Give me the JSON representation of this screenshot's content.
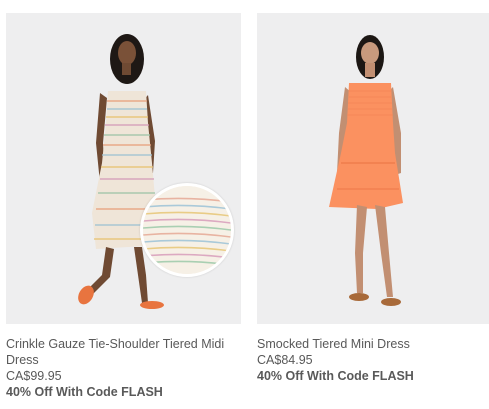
{
  "products": [
    {
      "name": "Crinkle Gauze Tie-Shoulder Tiered Midi Dress",
      "price": "CA$99.95",
      "promo": "40% Off With Code FLASH",
      "color": "#ece3d6",
      "swatch_icon": "stripe-swatch"
    },
    {
      "name": "Smocked Tiered Mini Dress",
      "price": "CA$84.95",
      "promo": "40% Off With Code FLASH",
      "color": "#fb9160"
    }
  ]
}
